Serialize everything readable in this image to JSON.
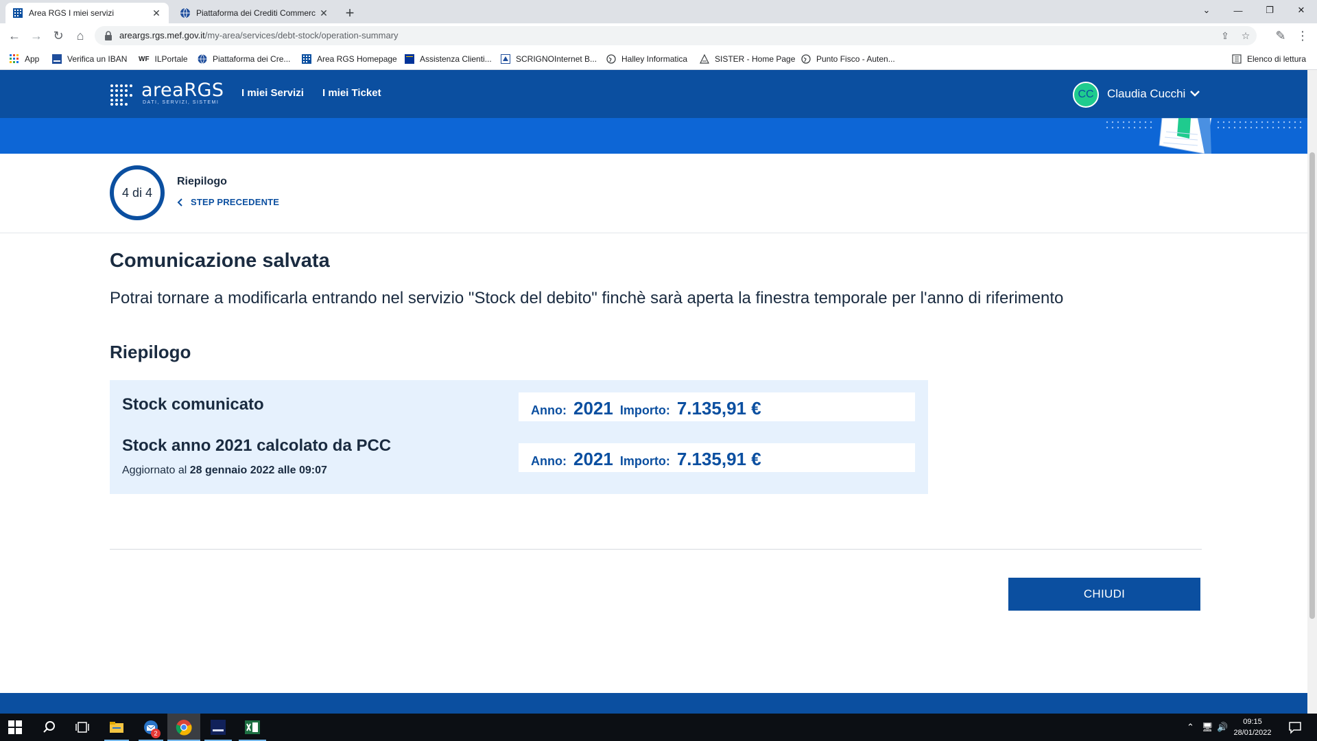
{
  "browser": {
    "tabs": [
      {
        "title": "Area RGS I miei servizi",
        "active": true
      },
      {
        "title": "Piattaforma dei Crediti Commerc",
        "active": false
      }
    ],
    "address": {
      "domain": "areargs.rgs.mef.gov.it",
      "path": "/my-area/services/debt-stock/operation-summary"
    },
    "bookmarks": [
      {
        "label": "App",
        "icon": "apps-grid-icon"
      },
      {
        "label": "Verifica un IBAN",
        "icon": "iban-icon"
      },
      {
        "label": "ILPortale",
        "icon": "wf-icon",
        "prefix": "WF"
      },
      {
        "label": "Piattaforma dei Cre...",
        "icon": "globe-icon"
      },
      {
        "label": "Area RGS Homepage",
        "icon": "areargs-icon"
      },
      {
        "label": "Assistenza Clienti...",
        "icon": "flag-icon"
      },
      {
        "label": "SCRIGNOInternet B...",
        "icon": "scrigno-icon"
      },
      {
        "label": "Halley Informatica",
        "icon": "globe-icon"
      },
      {
        "label": "SISTER - Home Page",
        "icon": "sister-icon"
      },
      {
        "label": "Punto Fisco - Auten...",
        "icon": "globe-icon"
      }
    ],
    "reading_list": "Elenco di lettura"
  },
  "header": {
    "logo": "areaRGS",
    "logo_sub": "DATI, SERVIZI, SISTEMI",
    "nav": [
      "I miei Servizi",
      "I miei Ticket"
    ],
    "user_initials": "CC",
    "user_name": "Claudia Cucchi",
    "colors": {
      "primary": "#0b4fa0",
      "band": "#0d66d6",
      "avatar": "#1fcb8e"
    }
  },
  "step": {
    "counter": "4 di 4",
    "title": "Riepilogo",
    "back_label": "STEP PRECEDENTE"
  },
  "main": {
    "heading": "Comunicazione salvata",
    "description": "Potrai tornare a modificarla entrando nel servizio \"Stock del debito\" finchè sarà aperta la finestra temporale per l'anno di riferimento",
    "summary_heading": "Riepilogo",
    "rows": [
      {
        "label": "Stock comunicato",
        "year_key": "Anno:",
        "year": "2021",
        "amount_key": "Importo:",
        "amount": "7.135,91 €"
      },
      {
        "label": "Stock anno 2021 calcolato da PCC",
        "year_key": "Anno:",
        "year": "2021",
        "amount_key": "Importo:",
        "amount": "7.135,91 €"
      }
    ],
    "updated_prefix": "Aggiornato al",
    "updated_value": "28 gennaio 2022 alle 09:07",
    "close_button": "CHIUDI"
  },
  "taskbar": {
    "apps": [
      "windows-start-icon",
      "search-icon",
      "task-view-icon",
      "file-explorer-icon",
      "thunderbird-icon",
      "chrome-icon",
      "app-icon",
      "excel-icon"
    ],
    "badge": "2",
    "time": "09:15",
    "date": "28/01/2022"
  }
}
